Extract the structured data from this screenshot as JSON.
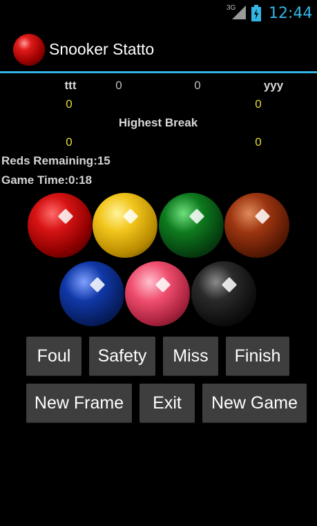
{
  "status_bar": {
    "network": "3G",
    "time": "12:44"
  },
  "app": {
    "title": "Snooker Statto"
  },
  "scoreboard": {
    "player1_name": "ttt",
    "player1_frames": "0",
    "player2_frames": "0",
    "player2_name": "yyy",
    "player1_score": "0",
    "player2_score": "0",
    "highest_break_label": "Highest Break",
    "player1_highest_break": "0",
    "player2_highest_break": "0"
  },
  "info": {
    "reds_remaining": "Reds Remaining:15",
    "game_time": "Game Time:0:18"
  },
  "balls": [
    {
      "name": "red",
      "color": "#c40f0f"
    },
    {
      "name": "yellow",
      "color": "#f2c51c"
    },
    {
      "name": "green",
      "color": "#0e7a1e"
    },
    {
      "name": "brown",
      "color": "#9c3510"
    },
    {
      "name": "blue",
      "color": "#1038a8"
    },
    {
      "name": "pink",
      "color": "#f04e6e"
    },
    {
      "name": "black",
      "color": "#1a1a1a"
    }
  ],
  "buttons": {
    "foul": "Foul",
    "safety": "Safety",
    "miss": "Miss",
    "finish": "Finish",
    "new_frame": "New Frame",
    "exit": "Exit",
    "new_game": "New Game"
  },
  "colors": {
    "accent": "#33b5e5",
    "score": "#e6dc3c",
    "button_bg": "#3e3e3e"
  }
}
